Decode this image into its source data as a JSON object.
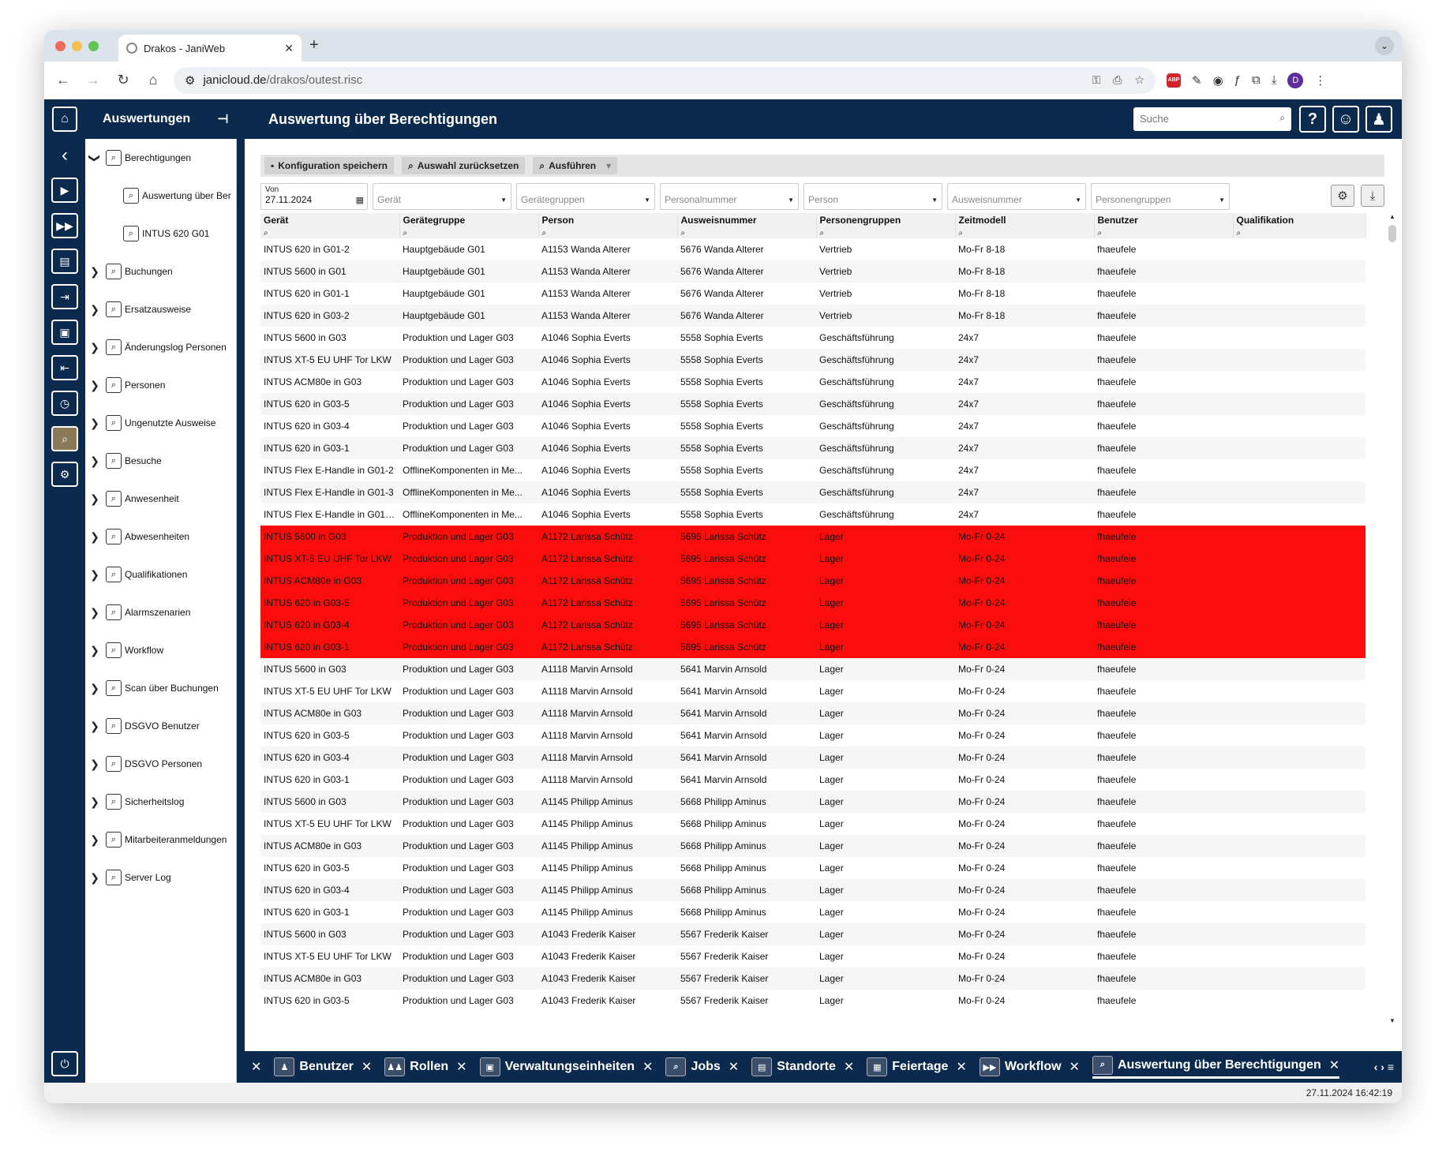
{
  "browser": {
    "tab_title": "Drakos - JaniWeb",
    "url_host": "janicloud.de",
    "url_path": "/drakos/outest.risc",
    "profile_initial": "D",
    "extension_abp": "ABP"
  },
  "header": {
    "section": "Auswertungen",
    "title": "Auswertung über Berechtigungen",
    "search_placeholder": "Suche"
  },
  "tree": [
    {
      "label": "Berechtigungen",
      "expanded": true,
      "arrow": "❯",
      "children": [
        {
          "label": "Auswertung über Ber"
        },
        {
          "label": "INTUS 620 G01"
        }
      ]
    },
    {
      "label": "Buchungen",
      "arrow": "❯"
    },
    {
      "label": "Ersatzausweise",
      "arrow": "❯"
    },
    {
      "label": "Änderungslog Personen",
      "arrow": "❯"
    },
    {
      "label": "Personen",
      "arrow": "❯"
    },
    {
      "label": "Ungenutzte Ausweise",
      "arrow": "❯"
    },
    {
      "label": "Besuche",
      "arrow": "❯"
    },
    {
      "label": "Anwesenheit",
      "arrow": "❯"
    },
    {
      "label": "Abwesenheiten",
      "arrow": "❯"
    },
    {
      "label": "Qualifikationen",
      "arrow": "❯"
    },
    {
      "label": "Alarmszenarien",
      "arrow": "❯"
    },
    {
      "label": "Workflow",
      "arrow": "❯"
    },
    {
      "label": "Scan über Buchungen",
      "arrow": "❯"
    },
    {
      "label": "DSGVO Benutzer",
      "arrow": "❯"
    },
    {
      "label": "DSGVO Personen",
      "arrow": "❯"
    },
    {
      "label": "Sicherheitslog",
      "arrow": "❯"
    },
    {
      "label": "Mitarbeiteranmeldungen",
      "arrow": "❯"
    },
    {
      "label": "Server Log",
      "arrow": "❯"
    }
  ],
  "toolbar": {
    "save_label": "Konfiguration speichern",
    "reset_label": "Auswahl zurücksetzen",
    "run_label": "Ausführen"
  },
  "filters": {
    "date_label": "Von",
    "date_value": "27.11.2024",
    "placeholders": [
      "Gerät",
      "Gerätegruppen",
      "Personalnummer",
      "Person",
      "Ausweisnummer",
      "Personengruppen"
    ]
  },
  "table": {
    "columns": [
      "Gerät",
      "Gerätegruppe",
      "Person",
      "Ausweisnummer",
      "Personengruppen",
      "Zeitmodell",
      "Benutzer",
      "Qualifikation"
    ],
    "highlight_color": "#fc0d0d",
    "rows": [
      {
        "c": [
          "INTUS 620 in G01-2",
          "Hauptgebäude G01",
          "A1153 Wanda Alterer",
          "5676 Wanda Alterer",
          "Vertrieb",
          "Mo-Fr 8-18",
          "fhaeufele",
          ""
        ]
      },
      {
        "c": [
          "INTUS 5600 in G01",
          "Hauptgebäude G01",
          "A1153 Wanda Alterer",
          "5676 Wanda Alterer",
          "Vertrieb",
          "Mo-Fr 8-18",
          "fhaeufele",
          ""
        ]
      },
      {
        "c": [
          "INTUS 620 in G01-1",
          "Hauptgebäude G01",
          "A1153 Wanda Alterer",
          "5676 Wanda Alterer",
          "Vertrieb",
          "Mo-Fr 8-18",
          "fhaeufele",
          ""
        ]
      },
      {
        "c": [
          "INTUS 620 in G03-2",
          "Hauptgebäude G01",
          "A1153 Wanda Alterer",
          "5676 Wanda Alterer",
          "Vertrieb",
          "Mo-Fr 8-18",
          "fhaeufele",
          ""
        ]
      },
      {
        "c": [
          "INTUS 5600 in G03",
          "Produktion und Lager G03",
          "A1046 Sophia Everts",
          "5558 Sophia Everts",
          "Geschäftsführung",
          "24x7",
          "fhaeufele",
          ""
        ]
      },
      {
        "c": [
          "INTUS XT-5 EU UHF Tor LKW",
          "Produktion und Lager G03",
          "A1046 Sophia Everts",
          "5558 Sophia Everts",
          "Geschäftsführung",
          "24x7",
          "fhaeufele",
          ""
        ]
      },
      {
        "c": [
          "INTUS ACM80e in G03",
          "Produktion und Lager G03",
          "A1046 Sophia Everts",
          "5558 Sophia Everts",
          "Geschäftsführung",
          "24x7",
          "fhaeufele",
          ""
        ]
      },
      {
        "c": [
          "INTUS 620 in G03-5",
          "Produktion und Lager G03",
          "A1046 Sophia Everts",
          "5558 Sophia Everts",
          "Geschäftsführung",
          "24x7",
          "fhaeufele",
          ""
        ]
      },
      {
        "c": [
          "INTUS 620 in G03-4",
          "Produktion und Lager G03",
          "A1046 Sophia Everts",
          "5558 Sophia Everts",
          "Geschäftsführung",
          "24x7",
          "fhaeufele",
          ""
        ]
      },
      {
        "c": [
          "INTUS 620 in G03-1",
          "Produktion und Lager G03",
          "A1046 Sophia Everts",
          "5558 Sophia Everts",
          "Geschäftsführung",
          "24x7",
          "fhaeufele",
          ""
        ]
      },
      {
        "c": [
          "INTUS Flex E-Handle in G01-2",
          "OfflineKomponenten in Me...",
          "A1046 Sophia Everts",
          "5558 Sophia Everts",
          "Geschäftsführung",
          "24x7",
          "fhaeufele",
          ""
        ]
      },
      {
        "c": [
          "INTUS Flex E-Handle in G01-3",
          "OfflineKomponenten in Me...",
          "A1046 Sophia Everts",
          "5558 Sophia Everts",
          "Geschäftsführung",
          "24x7",
          "fhaeufele",
          ""
        ]
      },
      {
        "c": [
          "INTUS Flex E-Handle in G01-...",
          "OfflineKomponenten in Me...",
          "A1046 Sophia Everts",
          "5558 Sophia Everts",
          "Geschäftsführung",
          "24x7",
          "fhaeufele",
          ""
        ]
      },
      {
        "c": [
          "INTUS 5600 in G03",
          "Produktion und Lager G03",
          "A1172 Larissa Schütz",
          "5695 Larissa Schütz",
          "Lager",
          "Mo-Fr 0-24",
          "fhaeufele",
          ""
        ],
        "hl": true
      },
      {
        "c": [
          "INTUS XT-5 EU UHF Tor LKW",
          "Produktion und Lager G03",
          "A1172 Larissa Schütz",
          "5695 Larissa Schütz",
          "Lager",
          "Mo-Fr 0-24",
          "fhaeufele",
          ""
        ],
        "hl": true
      },
      {
        "c": [
          "INTUS ACM80e in G03",
          "Produktion und Lager G03",
          "A1172 Larissa Schütz",
          "5695 Larissa Schütz",
          "Lager",
          "Mo-Fr 0-24",
          "fhaeufele",
          ""
        ],
        "hl": true
      },
      {
        "c": [
          "INTUS 620 in G03-5",
          "Produktion und Lager G03",
          "A1172 Larissa Schütz",
          "5695 Larissa Schütz",
          "Lager",
          "Mo-Fr 0-24",
          "fhaeufele",
          ""
        ],
        "hl": true
      },
      {
        "c": [
          "INTUS 620 in G03-4",
          "Produktion und Lager G03",
          "A1172 Larissa Schütz",
          "5695 Larissa Schütz",
          "Lager",
          "Mo-Fr 0-24",
          "fhaeufele",
          ""
        ],
        "hl": true
      },
      {
        "c": [
          "INTUS 620 in G03-1",
          "Produktion und Lager G03",
          "A1172 Larissa Schütz",
          "5695 Larissa Schütz",
          "Lager",
          "Mo-Fr 0-24",
          "fhaeufele",
          ""
        ],
        "hl": true
      },
      {
        "c": [
          "INTUS 5600 in G03",
          "Produktion und Lager G03",
          "A1118 Marvin Arnsold",
          "5641 Marvin Arnsold",
          "Lager",
          "Mo-Fr 0-24",
          "fhaeufele",
          ""
        ]
      },
      {
        "c": [
          "INTUS XT-5 EU UHF Tor LKW",
          "Produktion und Lager G03",
          "A1118 Marvin Arnsold",
          "5641 Marvin Arnsold",
          "Lager",
          "Mo-Fr 0-24",
          "fhaeufele",
          ""
        ]
      },
      {
        "c": [
          "INTUS ACM80e in G03",
          "Produktion und Lager G03",
          "A1118 Marvin Arnsold",
          "5641 Marvin Arnsold",
          "Lager",
          "Mo-Fr 0-24",
          "fhaeufele",
          ""
        ]
      },
      {
        "c": [
          "INTUS 620 in G03-5",
          "Produktion und Lager G03",
          "A1118 Marvin Arnsold",
          "5641 Marvin Arnsold",
          "Lager",
          "Mo-Fr 0-24",
          "fhaeufele",
          ""
        ]
      },
      {
        "c": [
          "INTUS 620 in G03-4",
          "Produktion und Lager G03",
          "A1118 Marvin Arnsold",
          "5641 Marvin Arnsold",
          "Lager",
          "Mo-Fr 0-24",
          "fhaeufele",
          ""
        ]
      },
      {
        "c": [
          "INTUS 620 in G03-1",
          "Produktion und Lager G03",
          "A1118 Marvin Arnsold",
          "5641 Marvin Arnsold",
          "Lager",
          "Mo-Fr 0-24",
          "fhaeufele",
          ""
        ]
      },
      {
        "c": [
          "INTUS 5600 in G03",
          "Produktion und Lager G03",
          "A1145 Philipp Aminus",
          "5668 Philipp Aminus",
          "Lager",
          "Mo-Fr 0-24",
          "fhaeufele",
          ""
        ]
      },
      {
        "c": [
          "INTUS XT-5 EU UHF Tor LKW",
          "Produktion und Lager G03",
          "A1145 Philipp Aminus",
          "5668 Philipp Aminus",
          "Lager",
          "Mo-Fr 0-24",
          "fhaeufele",
          ""
        ]
      },
      {
        "c": [
          "INTUS ACM80e in G03",
          "Produktion und Lager G03",
          "A1145 Philipp Aminus",
          "5668 Philipp Aminus",
          "Lager",
          "Mo-Fr 0-24",
          "fhaeufele",
          ""
        ]
      },
      {
        "c": [
          "INTUS 620 in G03-5",
          "Produktion und Lager G03",
          "A1145 Philipp Aminus",
          "5668 Philipp Aminus",
          "Lager",
          "Mo-Fr 0-24",
          "fhaeufele",
          ""
        ]
      },
      {
        "c": [
          "INTUS 620 in G03-4",
          "Produktion und Lager G03",
          "A1145 Philipp Aminus",
          "5668 Philipp Aminus",
          "Lager",
          "Mo-Fr 0-24",
          "fhaeufele",
          ""
        ]
      },
      {
        "c": [
          "INTUS 620 in G03-1",
          "Produktion und Lager G03",
          "A1145 Philipp Aminus",
          "5668 Philipp Aminus",
          "Lager",
          "Mo-Fr 0-24",
          "fhaeufele",
          ""
        ]
      },
      {
        "c": [
          "INTUS 5600 in G03",
          "Produktion und Lager G03",
          "A1043 Frederik Kaiser",
          "5567 Frederik Kaiser",
          "Lager",
          "Mo-Fr 0-24",
          "fhaeufele",
          ""
        ]
      },
      {
        "c": [
          "INTUS XT-5 EU UHF Tor LKW",
          "Produktion und Lager G03",
          "A1043 Frederik Kaiser",
          "5567 Frederik Kaiser",
          "Lager",
          "Mo-Fr 0-24",
          "fhaeufele",
          ""
        ]
      },
      {
        "c": [
          "INTUS ACM80e in G03",
          "Produktion und Lager G03",
          "A1043 Frederik Kaiser",
          "5567 Frederik Kaiser",
          "Lager",
          "Mo-Fr 0-24",
          "fhaeufele",
          ""
        ]
      },
      {
        "c": [
          "INTUS 620 in G03-5",
          "Produktion und Lager G03",
          "A1043 Frederik Kaiser",
          "5567 Frederik Kaiser",
          "Lager",
          "Mo-Fr 0-24",
          "fhaeufele",
          ""
        ]
      }
    ]
  },
  "bottom_tabs": [
    {
      "label": "Benutzer",
      "icon": "users-icon"
    },
    {
      "label": "Rollen",
      "icon": "roles-icon"
    },
    {
      "label": "Verwaltungseinheiten",
      "icon": "org-units-icon"
    },
    {
      "label": "Jobs",
      "icon": "search-icon"
    },
    {
      "label": "Standorte",
      "icon": "locations-icon"
    },
    {
      "label": "Feiertage",
      "icon": "calendar-icon"
    },
    {
      "label": "Workflow",
      "icon": "workflow-icon"
    },
    {
      "label": "Auswertung über Berechtigungen",
      "icon": "search-icon",
      "active": true
    }
  ],
  "status": {
    "datetime": "27.11.2024 16:42:19"
  }
}
